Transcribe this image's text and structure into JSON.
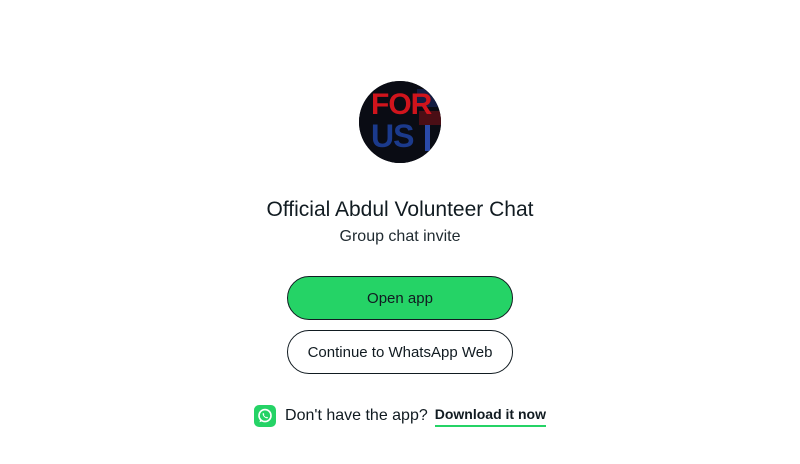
{
  "avatar": {
    "line1": "FOR",
    "line2": "US",
    "colors": {
      "line1": "#d0141c",
      "line2": "#1b3a8c",
      "background": "#0a0c14"
    }
  },
  "group": {
    "name": "Official Abdul Volunteer Chat",
    "subtitle": "Group chat invite"
  },
  "buttons": {
    "open_app": "Open app",
    "continue_web": "Continue to WhatsApp Web"
  },
  "footer": {
    "icon": "whatsapp-icon",
    "text": "Don't have the app?",
    "link": "Download it now"
  },
  "colors": {
    "accent": "#25d366",
    "text": "#111b21"
  }
}
